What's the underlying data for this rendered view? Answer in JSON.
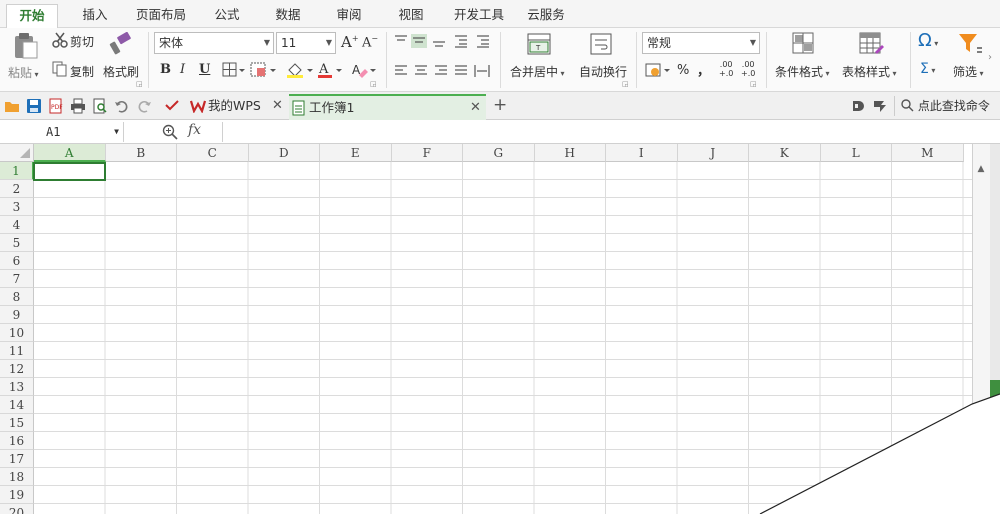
{
  "menu": {
    "tabs": [
      {
        "label": "开始",
        "active": true
      },
      {
        "label": "插入"
      },
      {
        "label": "页面布局"
      },
      {
        "label": "公式"
      },
      {
        "label": "数据"
      },
      {
        "label": "审阅"
      },
      {
        "label": "视图"
      },
      {
        "label": "开发工具"
      },
      {
        "label": "云服务"
      }
    ]
  },
  "ribbon": {
    "paste_label": "粘贴",
    "cut_label": "剪切",
    "copy_label": "复制",
    "format_painter_label": "格式刷",
    "font_name": "宋体",
    "font_size": "11",
    "bold": "B",
    "italic": "I",
    "underline": "U",
    "merge_center_label": "合并居中",
    "wrap_text_label": "自动换行",
    "number_format": "常规",
    "percent_symbol": "%",
    "comma_symbol": "，",
    "increase_decimal": ".00",
    "decrease_decimal": ".00",
    "conditional_format_label": "条件格式",
    "table_style_label": "表格样式",
    "symbol_glyph": "Ω",
    "sum_glyph": "Σ",
    "filter_label": "筛选"
  },
  "quickbar": {
    "tabs": [
      {
        "label": "我的WPS"
      },
      {
        "label": "工作簿1",
        "active": true
      }
    ],
    "add_tab": "+",
    "search_label": "点此查找命令"
  },
  "formula_bar": {
    "cell_ref": "A1",
    "fx_label": "fx",
    "value": ""
  },
  "grid": {
    "columns": [
      "A",
      "B",
      "C",
      "D",
      "E",
      "F",
      "G",
      "H",
      "I",
      "J",
      "K",
      "L",
      "M"
    ],
    "rows": [
      "1",
      "2",
      "3",
      "4",
      "5",
      "6",
      "7",
      "8",
      "9",
      "10",
      "11",
      "12",
      "13",
      "14",
      "15",
      "16",
      "17",
      "18",
      "19",
      "20"
    ],
    "selected_column": "A",
    "selected_row": "1"
  },
  "colors": {
    "accent_green": "#2f7d32",
    "tab_highlight": "#4caf50",
    "wps_red": "#c62828",
    "folder_orange": "#f0a030",
    "save_blue": "#1e6fb8",
    "filter_orange": "#f08c1e"
  }
}
